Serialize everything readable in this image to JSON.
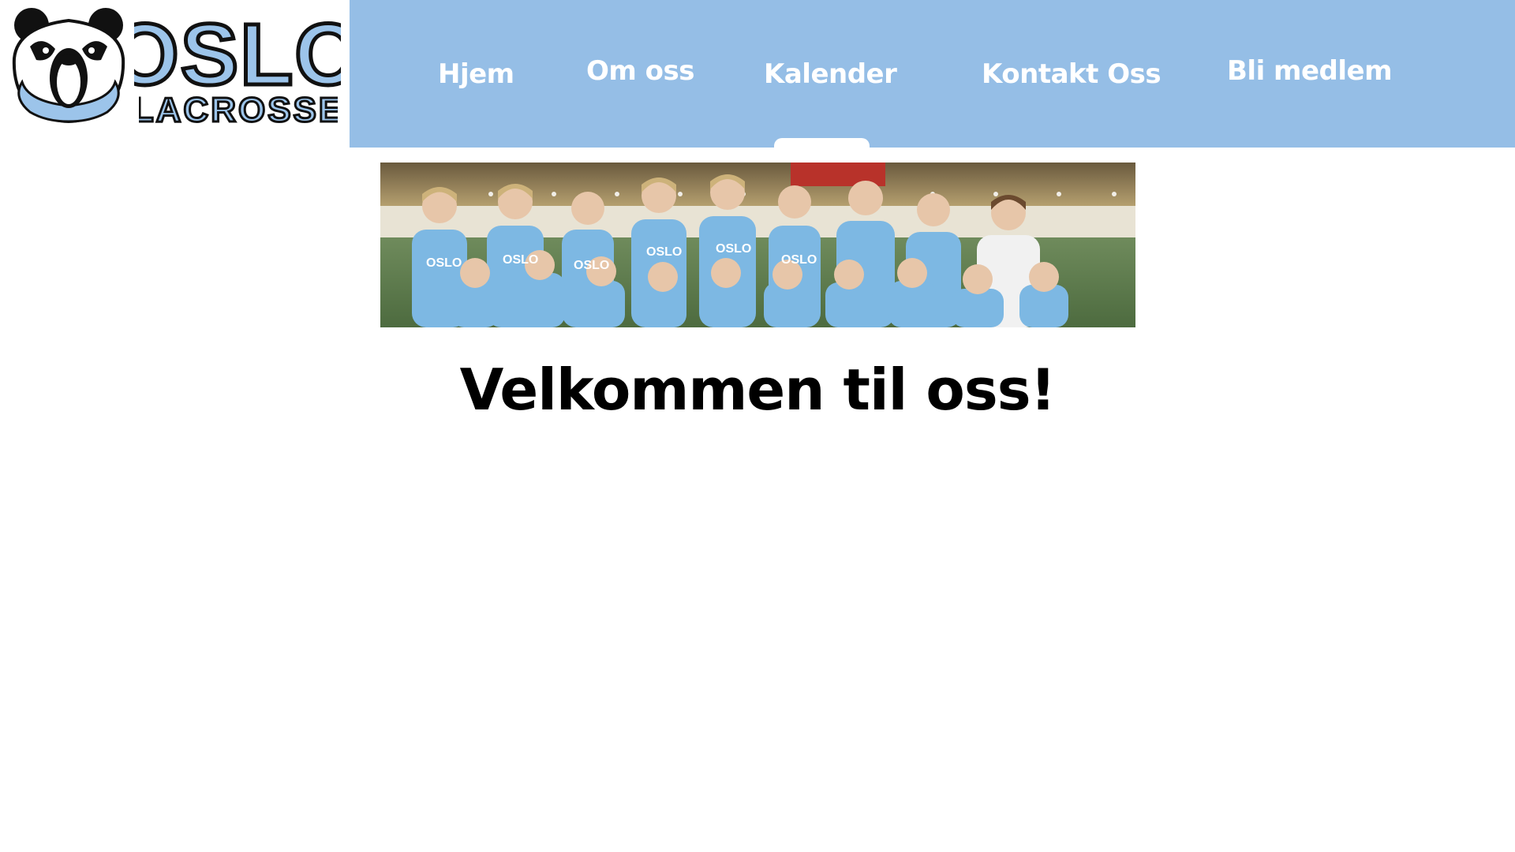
{
  "logo": {
    "line1": "OSLO",
    "line2": "LACROSSE",
    "mascot_icon": "panda-icon"
  },
  "nav": {
    "items": [
      {
        "label": "Hjem",
        "active": true
      },
      {
        "label": "Om oss"
      },
      {
        "label": "Kalender"
      },
      {
        "label": "Kontakt Oss"
      },
      {
        "label": "Bli medlem"
      }
    ]
  },
  "hero": {
    "alt": "team-photo",
    "jersey_text": "OSLO"
  },
  "main": {
    "heading": "Velkommen til oss!"
  },
  "colors": {
    "nav_bg": "#95bee6",
    "logo_blue": "#9cc4ea",
    "text": "#000000"
  }
}
